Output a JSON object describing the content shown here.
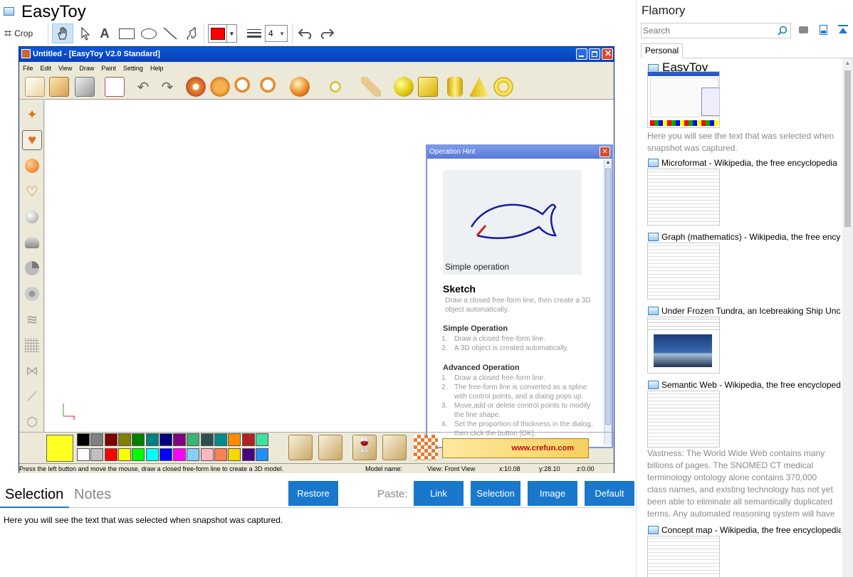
{
  "app": {
    "title": "EasyToy",
    "crop_label": "Crop",
    "stroke_width": "4"
  },
  "easytoy": {
    "window_title": "Untitled - [EasyToy V2.0 Standard]",
    "menu": [
      "File",
      "Edit",
      "View",
      "Draw",
      "Paint",
      "Setting",
      "Help"
    ],
    "status": {
      "message": "Press the left button and move the mouse, draw a closed free-form line to create a 3D model.",
      "model_name": "Model name:",
      "view": "View: Front View",
      "x": "x:10.08",
      "y": "y:28.10",
      "z": "z:0.00"
    },
    "hint": {
      "title": "Operation Hint",
      "caption": "Simple operation",
      "heading": "Sketch",
      "intro": "Draw a closed free-form line, then create a 3D object automatically.",
      "simple_title": "Simple Operation",
      "simple_1": "Draw a closed free-form line.",
      "simple_2": "A 3D object is created automatically.",
      "adv_title": "Advanced Operation",
      "adv_1": "Draw a closed free-form line.",
      "adv_2": "The free-form line is converted as a spline with control points, and a dialog pops up.",
      "adv_3": "Move,add or delete control points to modify the line shape.",
      "adv_4": "Set the proportion of thickness in the dialog, then click the button [OK]."
    },
    "banner": "www.crefun.com",
    "palette_top": [
      "#000000",
      "#808080",
      "#800000",
      "#808000",
      "#008000",
      "#008080",
      "#000080",
      "#800080",
      "#3cb371",
      "#2f4f4f",
      "#008b8b",
      "#ff8c00",
      "#b22222",
      "#40e0a0"
    ],
    "palette_bottom": [
      "#ffffff",
      "#c0c0c0",
      "#ff0000",
      "#ffff00",
      "#00ff00",
      "#00ffff",
      "#0000ff",
      "#ff00ff",
      "#87cefa",
      "#ffb6c1",
      "#ff7f50",
      "#ffd700",
      "#4b0082",
      "#1e90ff"
    ]
  },
  "bottom": {
    "tab_selection": "Selection",
    "tab_notes": "Notes",
    "restore": "Restore",
    "paste_label": "Paste:",
    "link": "Link",
    "selection_btn": "Selection",
    "image": "Image",
    "default": "Default",
    "body_text": "Here you will see the text that was selected when snapshot was captured."
  },
  "sidebar": {
    "title": "Flamory",
    "search_placeholder": "Search",
    "tab_personal": "Personal",
    "items": [
      {
        "title": "EasyToy"
      },
      {
        "title": "Microformat - Wikipedia, the free encyclopedia"
      },
      {
        "title": "Graph (mathematics) - Wikipedia, the free ency"
      },
      {
        "title": "Under Frozen Tundra, an Icebreaking Ship Unco"
      },
      {
        "title": "Semantic Web - Wikipedia, the free encycloped"
      },
      {
        "title": "Concept map - Wikipedia, the free encyclopedia"
      }
    ],
    "note_1": "Here you will see the text that was selected when snapshot was captured.",
    "note_2": "Vastness: The World Wide Web contains many billions of pages. The SNOMED CT medical terminology ontology alone contains 370,000 class names, and existing technology has not yet been able to eliminate all semantically duplicated terms. Any automated reasoning system will have to deal with truly huge inputs."
  },
  "colors": {
    "accent_blue": "#1a78cc",
    "current_color": "#ff0000",
    "xp_title": "#0a4fd0"
  }
}
